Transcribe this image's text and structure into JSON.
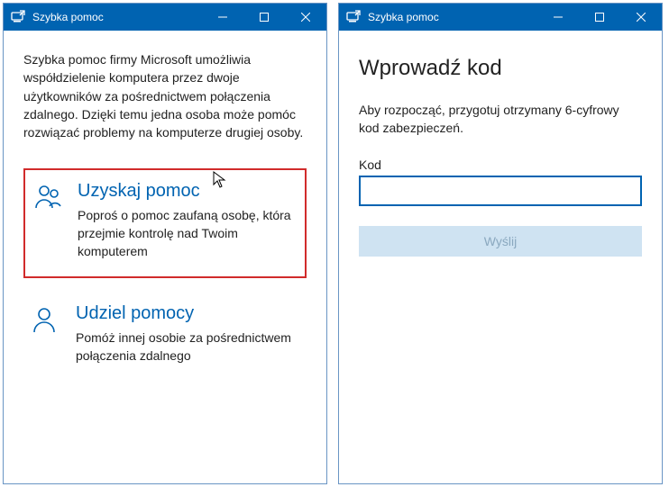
{
  "left": {
    "titlebar": {
      "title": "Szybka pomoc"
    },
    "intro": "Szybka pomoc firmy Microsoft umożliwia współdzielenie komputera przez dwoje użytkowników za pośrednictwem połączenia zdalnego. Dzięki temu jedna osoba może pomóc rozwiązać problemy na komputerze drugiej osoby.",
    "option_get": {
      "title": "Uzyskaj pomoc",
      "desc": "Poproś o pomoc zaufaną osobę, która przejmie kontrolę nad Twoim komputerem"
    },
    "option_give": {
      "title": "Udziel pomocy",
      "desc": "Pomóż innej osobie za pośrednictwem połączenia zdalnego"
    }
  },
  "right": {
    "titlebar": {
      "title": "Szybka pomoc"
    },
    "heading": "Wprowadź kod",
    "lead": "Aby rozpocząć, przygotuj otrzymany 6-cyfrowy kod zabezpieczeń.",
    "code_label": "Kod",
    "code_value": "",
    "send_label": "Wyślij"
  }
}
